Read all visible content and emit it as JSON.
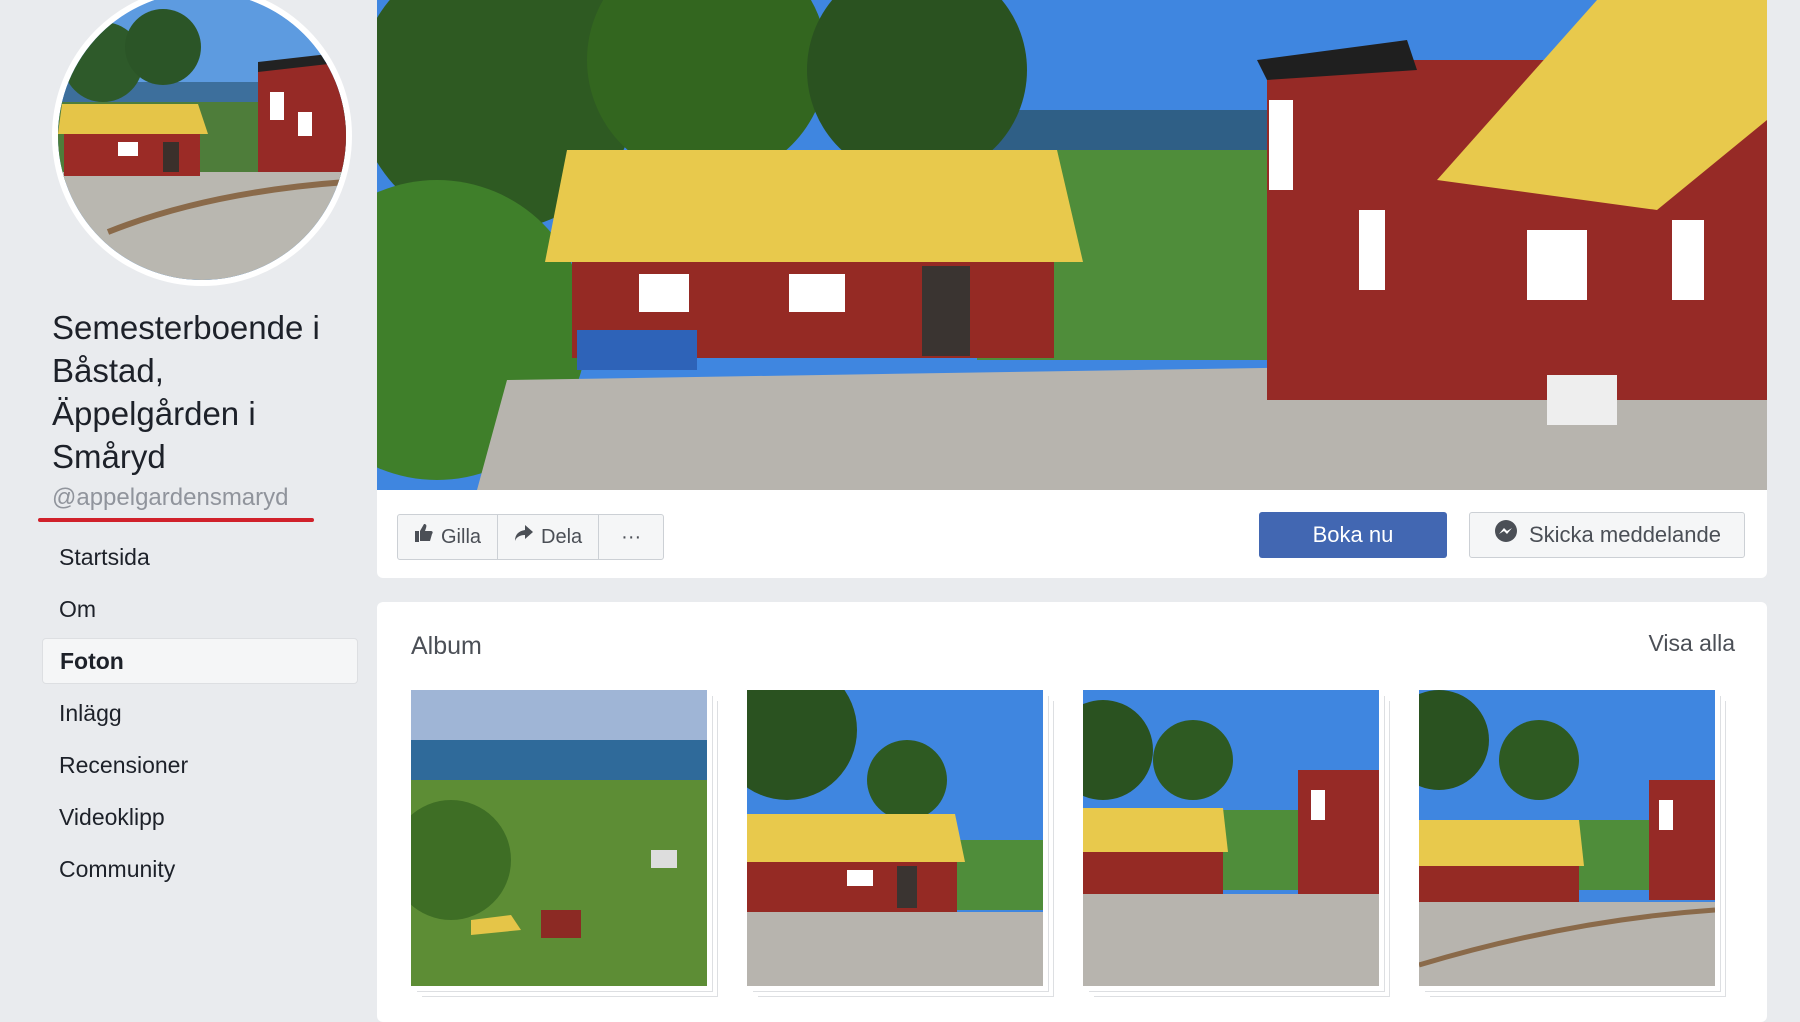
{
  "page": {
    "name": "Semesterboende i Båstad, Äppelgården i Småryd",
    "handle": "@appelgardensmaryd"
  },
  "nav": {
    "items": [
      {
        "label": "Startsida"
      },
      {
        "label": "Om"
      },
      {
        "label": "Foton",
        "active": true
      },
      {
        "label": "Inlägg"
      },
      {
        "label": "Recensioner"
      },
      {
        "label": "Videoklipp"
      },
      {
        "label": "Community"
      }
    ]
  },
  "actions": {
    "like_label": "Gilla",
    "share_label": "Dela",
    "more_label": "···",
    "book_label": "Boka nu",
    "message_label": "Skicka meddelande"
  },
  "album": {
    "title": "Album",
    "view_all": "Visa alla"
  },
  "colors": {
    "brand": "#4267b2",
    "underline": "#d0202a",
    "house_red": "#8e2a26",
    "roof_yellow": "#e8c94c"
  }
}
